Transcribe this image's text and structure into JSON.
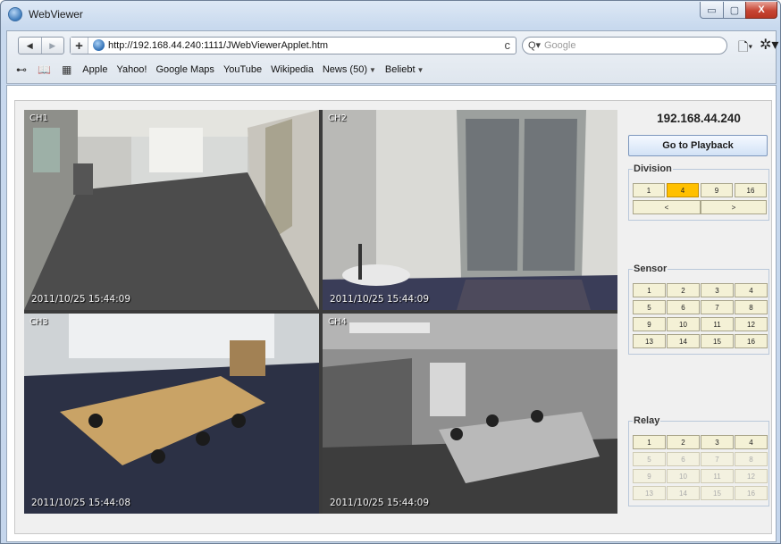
{
  "window": {
    "title": "WebViewer",
    "min_glyph": "▭",
    "max_glyph": "▢",
    "close_glyph": "X"
  },
  "toolbar": {
    "back_glyph": "◀",
    "forward_glyph": "▶",
    "add_glyph": "+",
    "url": "http://192.168.44.240:1111/JWebViewerApplet.htm",
    "reload_glyph": "c",
    "search_glyph": "Q▾",
    "search_placeholder": "Google",
    "page_menu_glyph": "🗋▾",
    "gear_menu_glyph": "✲▾"
  },
  "bookmarks": {
    "icons": [
      "reader-glasses-icon",
      "book-icon",
      "grid-icon"
    ],
    "icon_glyphs": [
      "⊷",
      "📖",
      "▦"
    ],
    "items": [
      "Apple",
      "Yahoo!",
      "Google Maps",
      "YouTube",
      "Wikipedia"
    ],
    "news_label": "News (50)",
    "beliebt_label": "Beliebt",
    "dropdown_glyph": "▼"
  },
  "viewer": {
    "ip": "192.168.44.240",
    "playback_label": "Go to Playback",
    "cameras": [
      {
        "label": "CH1",
        "timestamp": "2011/10/25 15:44:09"
      },
      {
        "label": "CH2",
        "timestamp": "2011/10/25 15:44:09"
      },
      {
        "label": "CH3",
        "timestamp": "2011/10/25 15:44:08"
      },
      {
        "label": "CH4",
        "timestamp": "2011/10/25 15:44:09"
      }
    ],
    "division": {
      "title": "Division",
      "options": [
        "1",
        "4",
        "9",
        "16"
      ],
      "selected": "4",
      "prev": "<",
      "next": ">"
    },
    "sensor": {
      "title": "Sensor",
      "buttons": [
        "1",
        "2",
        "3",
        "4",
        "5",
        "6",
        "7",
        "8",
        "9",
        "10",
        "11",
        "12",
        "13",
        "14",
        "15",
        "16"
      ]
    },
    "relay": {
      "title": "Relay",
      "buttons": [
        "1",
        "2",
        "3",
        "4",
        "5",
        "6",
        "7",
        "8",
        "9",
        "10",
        "11",
        "12",
        "13",
        "14",
        "15",
        "16"
      ],
      "enabled_count": 4
    }
  },
  "colors": {
    "active_division": "#ffc000",
    "button_face": "#f4f1d6"
  }
}
